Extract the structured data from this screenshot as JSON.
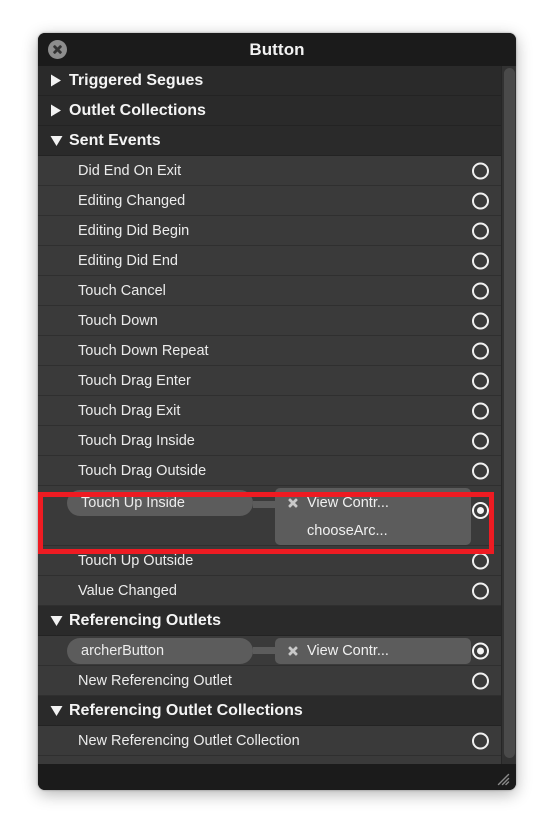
{
  "window": {
    "title": "Button",
    "close_icon": "close-icon",
    "resize_grip_icon": "resize-grip-icon"
  },
  "colors": {
    "highlight": "#ee1b22",
    "window_bg": "#1d1d1d",
    "section_bg": "#2a2a2a",
    "row_bg": "#3a3a3a",
    "pill_bg": "#5c5c5c",
    "text": "#ececec"
  },
  "sections": [
    {
      "label": "Triggered Segues",
      "expanded": false,
      "disclosure_icon": "triangle-right-icon",
      "rows": []
    },
    {
      "label": "Outlet Collections",
      "expanded": false,
      "disclosure_icon": "triangle-right-icon",
      "rows": []
    },
    {
      "label": "Sent Events",
      "expanded": true,
      "disclosure_icon": "triangle-down-icon",
      "rows": [
        {
          "label": "Did End On Exit",
          "connected": false,
          "connector_state": "empty"
        },
        {
          "label": "Editing Changed",
          "connected": false,
          "connector_state": "empty"
        },
        {
          "label": "Editing Did Begin",
          "connected": false,
          "connector_state": "empty"
        },
        {
          "label": "Editing Did End",
          "connected": false,
          "connector_state": "empty"
        },
        {
          "label": "Touch Cancel",
          "connected": false,
          "connector_state": "empty"
        },
        {
          "label": "Touch Down",
          "connected": false,
          "connector_state": "empty"
        },
        {
          "label": "Touch Down Repeat",
          "connected": false,
          "connector_state": "empty"
        },
        {
          "label": "Touch Drag Enter",
          "connected": false,
          "connector_state": "empty"
        },
        {
          "label": "Touch Drag Exit",
          "connected": false,
          "connector_state": "empty"
        },
        {
          "label": "Touch Drag Inside",
          "connected": false,
          "connector_state": "empty"
        },
        {
          "label": "Touch Drag Outside",
          "connected": false,
          "connector_state": "empty"
        },
        {
          "label": "Touch Up Inside",
          "connected": true,
          "connector_state": "filled",
          "highlighted": true,
          "popover": {
            "close_icon": "popover-x-icon",
            "line1": "View Contr...",
            "line2": "chooseArc..."
          }
        },
        {
          "label": "Touch Up Outside",
          "connected": false,
          "connector_state": "empty"
        },
        {
          "label": "Value Changed",
          "connected": false,
          "connector_state": "empty"
        }
      ]
    },
    {
      "label": "Referencing Outlets",
      "expanded": true,
      "disclosure_icon": "triangle-down-icon",
      "rows": [
        {
          "label": "archerButton",
          "connected": true,
          "connector_state": "filled",
          "popover": {
            "close_icon": "popover-x-icon",
            "line1": "View Contr...",
            "line2": ""
          }
        },
        {
          "label": "New Referencing Outlet",
          "connected": false,
          "connector_state": "empty"
        }
      ]
    },
    {
      "label": "Referencing Outlet Collections",
      "expanded": true,
      "disclosure_icon": "triangle-down-icon",
      "rows": [
        {
          "label": "New Referencing Outlet Collection",
          "connected": false,
          "connector_state": "empty"
        }
      ]
    }
  ]
}
